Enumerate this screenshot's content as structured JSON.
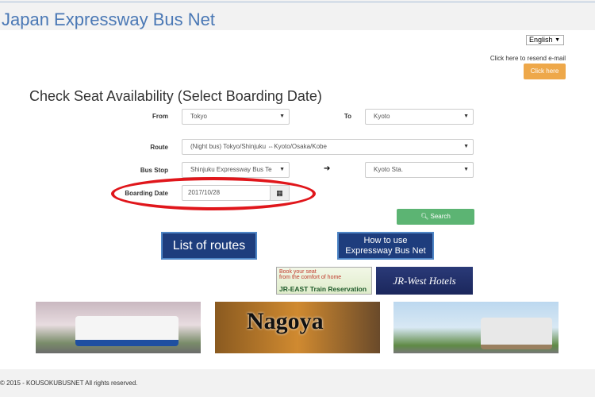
{
  "header": {
    "title": "Japan Expressway Bus Net"
  },
  "language": {
    "selected": "English"
  },
  "resend": {
    "text": "Click here to resend e-mail",
    "button": "Click here"
  },
  "form": {
    "heading": "Check Seat Availability (Select Boarding Date)",
    "from_label": "From",
    "from_value": "Tokyo",
    "to_label": "To",
    "to_value": "Kyoto",
    "route_label": "Route",
    "route_value": "(Night bus) Tokyo/Shinjuku ⇔Kyoto/Osaka/Kobe",
    "busstop_label": "Bus Stop",
    "busstop_from": "Shinjuku Expressway Bus Te",
    "busstop_to": "Kyoto Sta.",
    "date_label": "Boarding Date",
    "date_value": "2017/10/28",
    "search_button": "Search",
    "highlight_color": "#e0161b"
  },
  "banners": {
    "list_of_routes": "List of routes",
    "how_to_use_1": "How to use",
    "how_to_use_2": "Expressway Bus Net",
    "jreast_line1": "Book your seat",
    "jreast_line2": "from the comfort of home",
    "jreast_title": "JR-EAST Train Reservation",
    "jrwest": "JR-West Hotels",
    "nagoya": "Nagoya"
  },
  "footer": {
    "text": "© 2015 - KOUSOKUBUSNET All rights reserved."
  }
}
